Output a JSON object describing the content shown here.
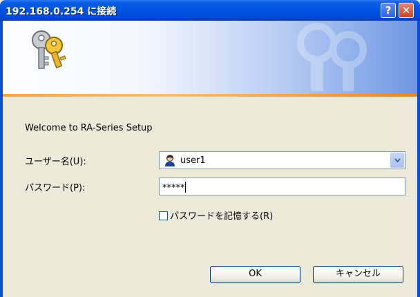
{
  "window": {
    "title": "192.168.0.254 に接続",
    "help_glyph": "?",
    "close_glyph": "✕"
  },
  "dialog": {
    "message": "Welcome to RA-Series Setup",
    "username": {
      "label": "ユーザー名(U):",
      "value": "user1"
    },
    "password": {
      "label": "パスワード(P):",
      "value": "*****"
    },
    "remember": {
      "label": "パスワードを記憶する(R)",
      "checked": false
    },
    "buttons": {
      "ok": "OK",
      "cancel": "キャンセル"
    }
  },
  "icons": {
    "banner": "keys-icon",
    "user": "user-avatar-icon",
    "dropdown": "chevron-down-icon"
  },
  "colors": {
    "titlebar": "#0053e0",
    "dialog_bg": "#ece9d8",
    "accent_line": "#f3a44a"
  }
}
